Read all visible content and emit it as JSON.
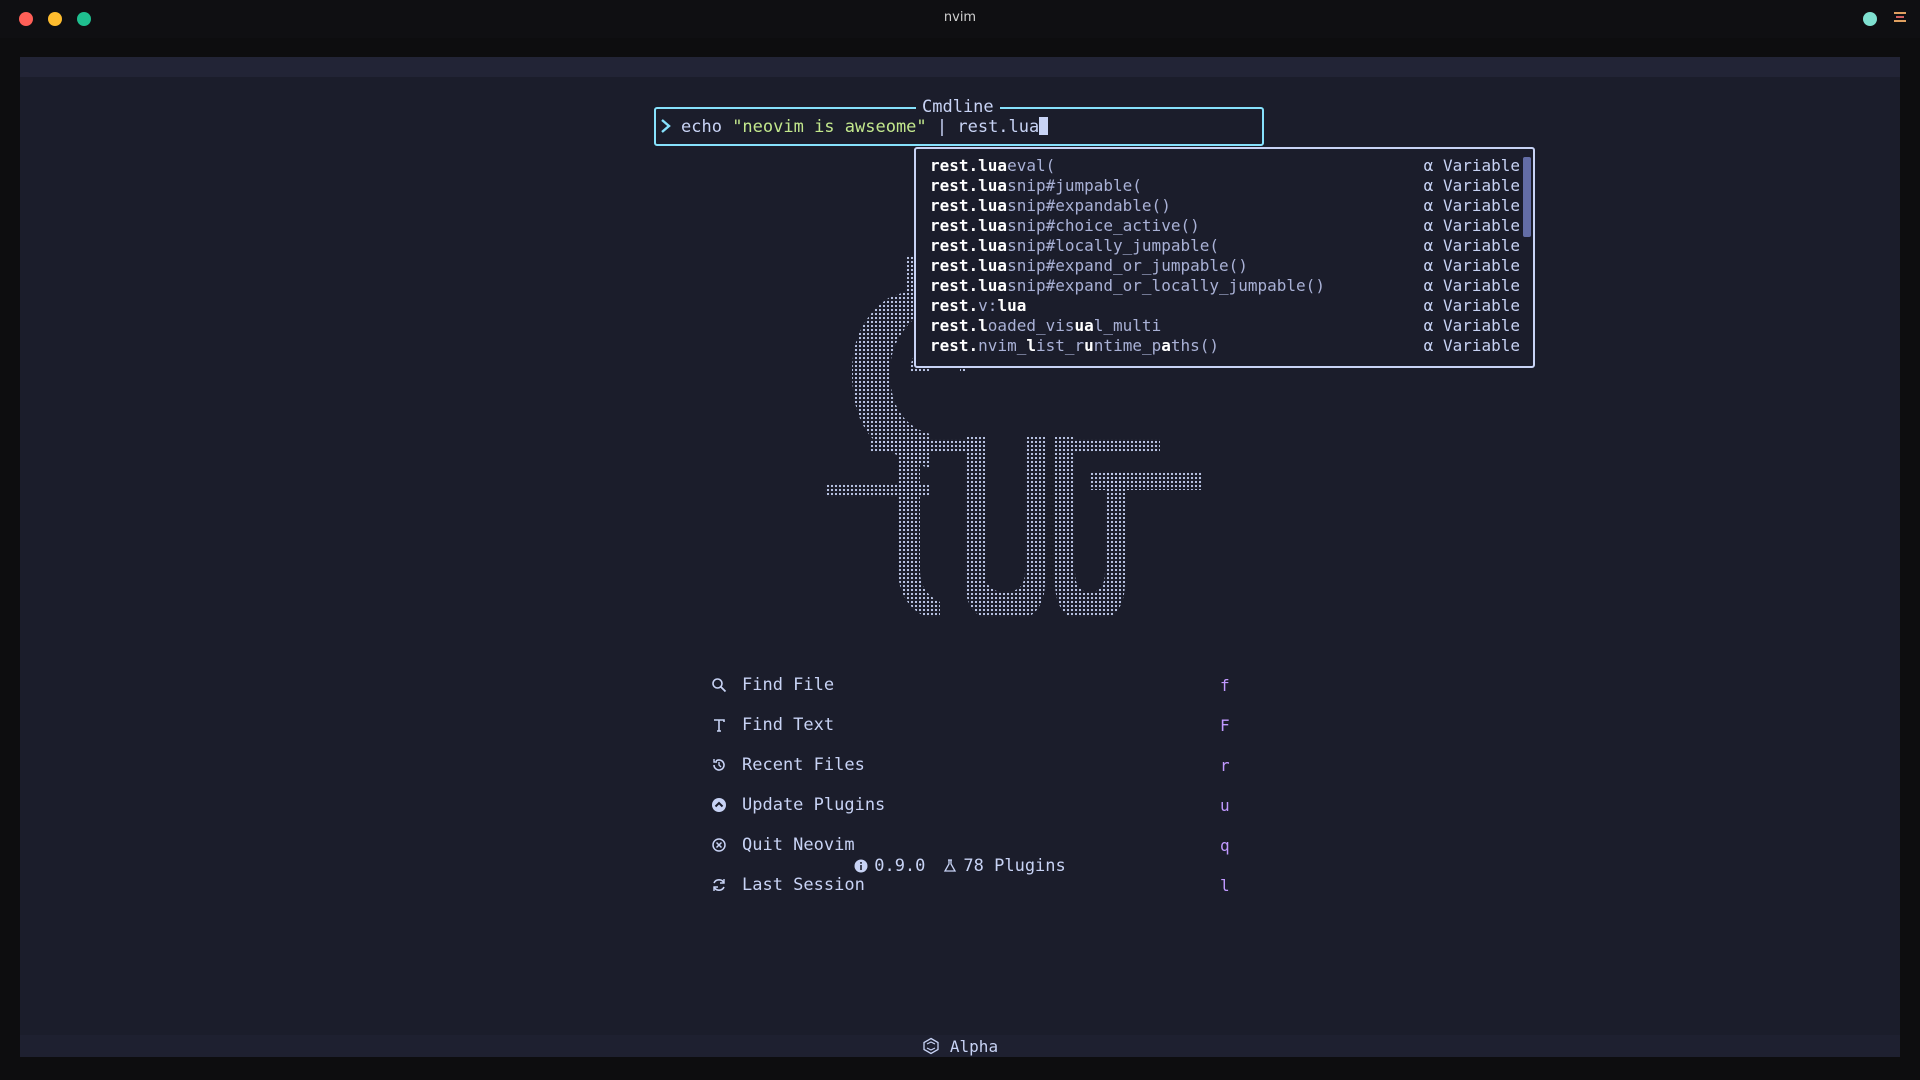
{
  "window": {
    "title": "nvim"
  },
  "cmdline": {
    "title": "Cmdline",
    "cmd": "echo ",
    "string": "\"neovim is awseome\"",
    "rest": " | rest.lua"
  },
  "completion": {
    "items": [
      {
        "segments": [
          {
            "t": "rest.lua",
            "b": true
          },
          {
            "t": "eval(",
            "b": false
          }
        ],
        "kind": "α Variable"
      },
      {
        "segments": [
          {
            "t": "rest.lua",
            "b": true
          },
          {
            "t": "snip#jumpable(",
            "b": false
          }
        ],
        "kind": "α Variable"
      },
      {
        "segments": [
          {
            "t": "rest.lua",
            "b": true
          },
          {
            "t": "snip#expandable()",
            "b": false
          }
        ],
        "kind": "α Variable"
      },
      {
        "segments": [
          {
            "t": "rest.lua",
            "b": true
          },
          {
            "t": "snip#choice_active()",
            "b": false
          }
        ],
        "kind": "α Variable"
      },
      {
        "segments": [
          {
            "t": "rest.lua",
            "b": true
          },
          {
            "t": "snip#locally_jumpable(",
            "b": false
          }
        ],
        "kind": "α Variable"
      },
      {
        "segments": [
          {
            "t": "rest.lua",
            "b": true
          },
          {
            "t": "snip#expand_or_jumpable()",
            "b": false
          }
        ],
        "kind": "α Variable"
      },
      {
        "segments": [
          {
            "t": "rest.lua",
            "b": true
          },
          {
            "t": "snip#expand_or_locally_jumpable()",
            "b": false
          }
        ],
        "kind": "α Variable"
      },
      {
        "segments": [
          {
            "t": "rest.",
            "b": true
          },
          {
            "t": "v:",
            "b": false
          },
          {
            "t": "lua",
            "b": true
          }
        ],
        "kind": "α Variable"
      },
      {
        "segments": [
          {
            "t": "rest.l",
            "b": true
          },
          {
            "t": "oaded_vis",
            "b": false
          },
          {
            "t": "ua",
            "b": true
          },
          {
            "t": "l_multi",
            "b": false
          }
        ],
        "kind": "α Variable"
      },
      {
        "segments": [
          {
            "t": "rest.",
            "b": true
          },
          {
            "t": "nvim_",
            "b": false
          },
          {
            "t": "l",
            "b": true
          },
          {
            "t": "ist_r",
            "b": false
          },
          {
            "t": "u",
            "b": true
          },
          {
            "t": "ntime_p",
            "b": false
          },
          {
            "t": "a",
            "b": true
          },
          {
            "t": "ths()",
            "b": false
          }
        ],
        "kind": "α Variable"
      }
    ]
  },
  "dashboard": {
    "buttons": [
      {
        "icon": "search-icon",
        "label": "Find File",
        "key": "f"
      },
      {
        "icon": "text-icon",
        "label": "Find Text",
        "key": "F"
      },
      {
        "icon": "history-icon",
        "label": "Recent Files",
        "key": "r"
      },
      {
        "icon": "update-icon",
        "label": "Update Plugins",
        "key": "u"
      },
      {
        "icon": "quit-icon",
        "label": "Quit Neovim",
        "key": "q"
      },
      {
        "icon": "session-icon",
        "label": "Last Session",
        "key": "l"
      }
    ],
    "footer": {
      "version": "0.9.0",
      "plugins": "78 Plugins"
    }
  },
  "statusline": {
    "mode": "Alpha"
  },
  "colors": {
    "background": "#1b1d2b",
    "accent": "#86e1fc",
    "key": "#c099ff",
    "string": "#c3e88d"
  }
}
